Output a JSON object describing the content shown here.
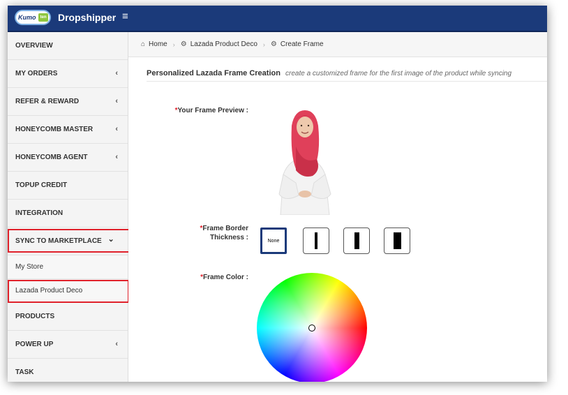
{
  "header": {
    "logo_text": "Kumo",
    "logo_tag": "ten",
    "app_title": "Dropshipper",
    "menu_icon": "≡"
  },
  "sidebar": {
    "items": [
      {
        "label": "OVERVIEW",
        "chevron": ""
      },
      {
        "label": "MY ORDERS",
        "chevron": "‹"
      },
      {
        "label": "REFER & REWARD",
        "chevron": "‹"
      },
      {
        "label": "HONEYCOMB MASTER",
        "chevron": "‹"
      },
      {
        "label": "HONEYCOMB AGENT",
        "chevron": "‹"
      },
      {
        "label": "TOPUP CREDIT",
        "chevron": ""
      },
      {
        "label": "INTEGRATION",
        "chevron": ""
      },
      {
        "label": "SYNC TO MARKETPLACE",
        "chevron": "⌄"
      }
    ],
    "sub_items": [
      {
        "label": "My Store"
      },
      {
        "label": "Lazada Product Deco"
      }
    ],
    "items_after": [
      {
        "label": "PRODUCTS",
        "chevron": ""
      },
      {
        "label": "POWER UP",
        "chevron": "‹"
      },
      {
        "label": "TASK",
        "chevron": ""
      }
    ],
    "highlight_color": "#e0212b"
  },
  "breadcrumb": {
    "home_icon": "⌂",
    "home": "Home",
    "cog_icon": "⚙",
    "level1": "Lazada Product Deco",
    "level2": "Create Frame",
    "separator": "›"
  },
  "page": {
    "title": "Personalized Lazada Frame Creation",
    "subtitle": "create a customized frame for the first image of the product while syncing"
  },
  "form": {
    "required_mark": "*",
    "preview_label": "Your Frame Preview :",
    "thickness_label_1": "Frame Border",
    "thickness_label_2": "Thickness :",
    "thickness_options": [
      {
        "label": "None",
        "selected": true
      },
      {
        "label": "",
        "width_level": 1
      },
      {
        "label": "",
        "width_level": 2
      },
      {
        "label": "",
        "width_level": 3
      }
    ],
    "color_label": "Frame Color :"
  },
  "colors": {
    "topbar": "#1b3a7a",
    "accent_red": "#e0212b",
    "hijab": "#e0405a"
  }
}
